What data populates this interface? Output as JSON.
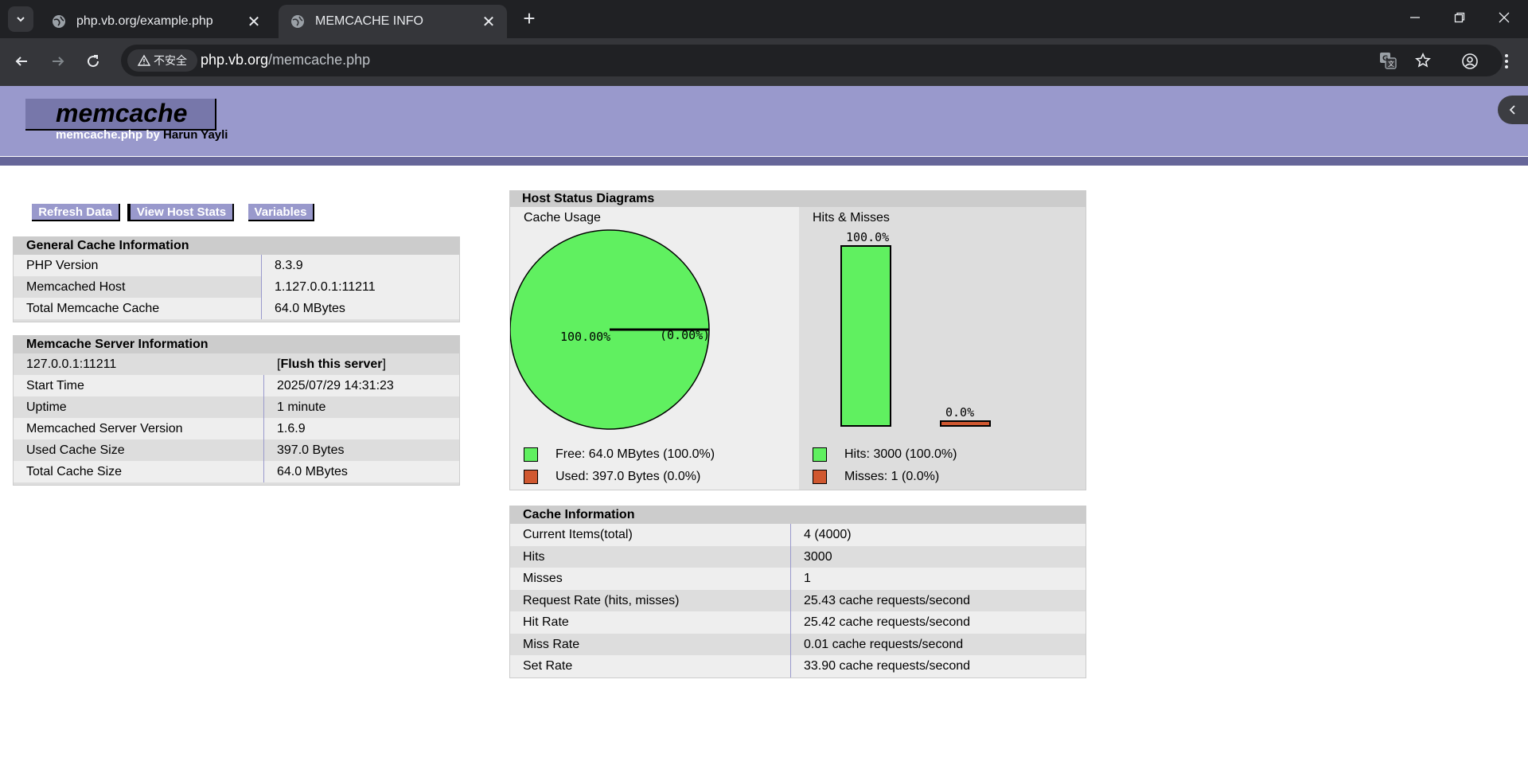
{
  "browser": {
    "tabs": [
      {
        "title": "php.vb.org/example.php",
        "active": false
      },
      {
        "title": "MEMCACHE INFO",
        "active": true
      }
    ],
    "new_tab_label": "+",
    "security_label": "不安全",
    "url_domain": "php.vb.org",
    "url_path": "/memcache.php"
  },
  "header": {
    "logo": "memcache",
    "byline_script": "memcache.php by ",
    "byline_author": "Harun Yayli"
  },
  "menu": {
    "refresh": "Refresh Data",
    "host_stats": "View Host Stats",
    "variables": "Variables"
  },
  "general": {
    "title": "General Cache Information",
    "rows": [
      {
        "label": "PHP Version",
        "value": "8.3.9"
      },
      {
        "label": "Memcached Host",
        "value": "1.127.0.0.1:11211"
      },
      {
        "label": "Total Memcache Cache",
        "value": "64.0 MBytes"
      }
    ]
  },
  "server": {
    "title": "Memcache Server Information",
    "host": "127.0.0.1:11211",
    "flush_label": "Flush this server",
    "rows": [
      {
        "label": "Start Time",
        "value": "2025/07/29 14:31:23"
      },
      {
        "label": "Uptime",
        "value": "1 minute"
      },
      {
        "label": "Memcached Server Version",
        "value": "1.6.9"
      },
      {
        "label": "Used Cache Size",
        "value": "397.0 Bytes"
      },
      {
        "label": "Total Cache Size",
        "value": "64.0 MBytes"
      }
    ]
  },
  "diagrams": {
    "title": "Host Status Diagrams",
    "cache_usage": {
      "title": "Cache Usage",
      "free_label": "Free: 64.0 MBytes (100.0%)",
      "used_label": "Used: 397.0 Bytes (0.0%)"
    },
    "hits_misses": {
      "title": "Hits & Misses",
      "hits_label": "Hits: 3000 (100.0%)",
      "misses_label": "Misses: 1 (0.0%)"
    },
    "colors": {
      "green": "#60F060",
      "orange": "#D05830"
    }
  },
  "chart_data": [
    {
      "type": "pie",
      "title": "Cache Usage",
      "slices": [
        {
          "label": "100.00%",
          "value": 100.0,
          "color": "#60F060"
        },
        {
          "label": "(0.00%)",
          "value": 0.0,
          "color": "#D05830"
        }
      ]
    },
    {
      "type": "bar",
      "title": "Hits & Misses",
      "categories": [
        "Hits",
        "Misses"
      ],
      "values": [
        100.0,
        0.0
      ],
      "value_labels": [
        "100.0%",
        "0.0%"
      ],
      "colors": [
        "#60F060",
        "#D05830"
      ],
      "ylim": [
        0,
        100
      ]
    }
  ],
  "cache_info": {
    "title": "Cache Information",
    "rows": [
      {
        "label": "Current Items(total)",
        "value": "4 (4000)"
      },
      {
        "label": "Hits",
        "value": "3000"
      },
      {
        "label": "Misses",
        "value": "1"
      },
      {
        "label": "Request Rate (hits, misses)",
        "value": "25.43 cache requests/second"
      },
      {
        "label": "Hit Rate",
        "value": "25.42 cache requests/second"
      },
      {
        "label": "Miss Rate",
        "value": "0.01 cache requests/second"
      },
      {
        "label": "Set Rate",
        "value": "33.90 cache requests/second"
      }
    ]
  }
}
